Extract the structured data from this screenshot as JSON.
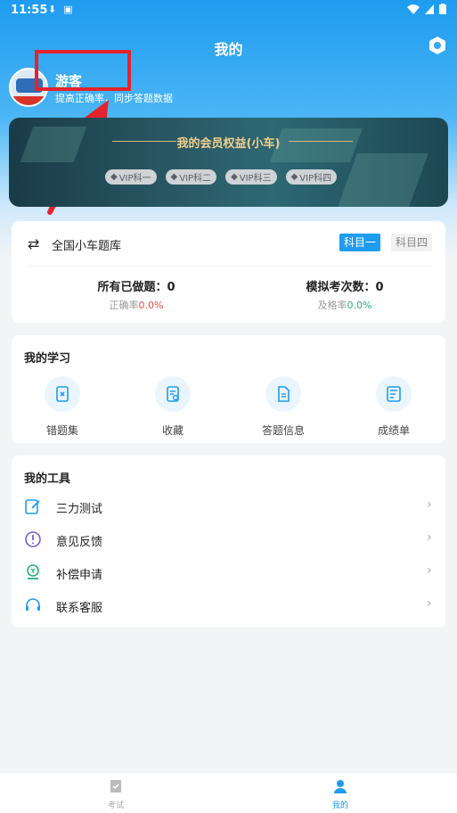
{
  "status_bar": {
    "time": "11:55"
  },
  "header": {
    "title": "我的"
  },
  "user": {
    "name": "游客",
    "subtitle": "提高正确率，同步答题数据"
  },
  "vip": {
    "title": "我的会员权益(小车)",
    "chips": [
      "VIP科一",
      "VIP科二",
      "VIP科三",
      "VIP科四"
    ]
  },
  "bank": {
    "name": "全国小车题库",
    "subjects": [
      "科目一",
      "科目四"
    ],
    "done_label": "所有已做题：0",
    "accuracy_label": "正确率",
    "accuracy_value": "0.0%",
    "exam_label": "模拟考次数：0",
    "pass_label": "及格率",
    "pass_value": "0.0%"
  },
  "study": {
    "title": "我的学习",
    "items": [
      "错题集",
      "收藏",
      "答题信息",
      "成绩单"
    ]
  },
  "tools": {
    "title": "我的工具",
    "items": [
      {
        "label": "三力测试",
        "icon": "edit-icon",
        "color": "#1e9cf0"
      },
      {
        "label": "意见反馈",
        "icon": "alert-circle-icon",
        "color": "#7a5cd6"
      },
      {
        "label": "补偿申请",
        "icon": "compensation-icon",
        "color": "#25b27a"
      },
      {
        "label": "联系客服",
        "icon": "headset-icon",
        "color": "#1e9cf0"
      }
    ]
  },
  "tabbar": {
    "items": [
      "考试",
      "我的"
    ],
    "active": "我的"
  },
  "colors": {
    "accent": "#1e9cf0",
    "annotation": "#e4232d"
  }
}
